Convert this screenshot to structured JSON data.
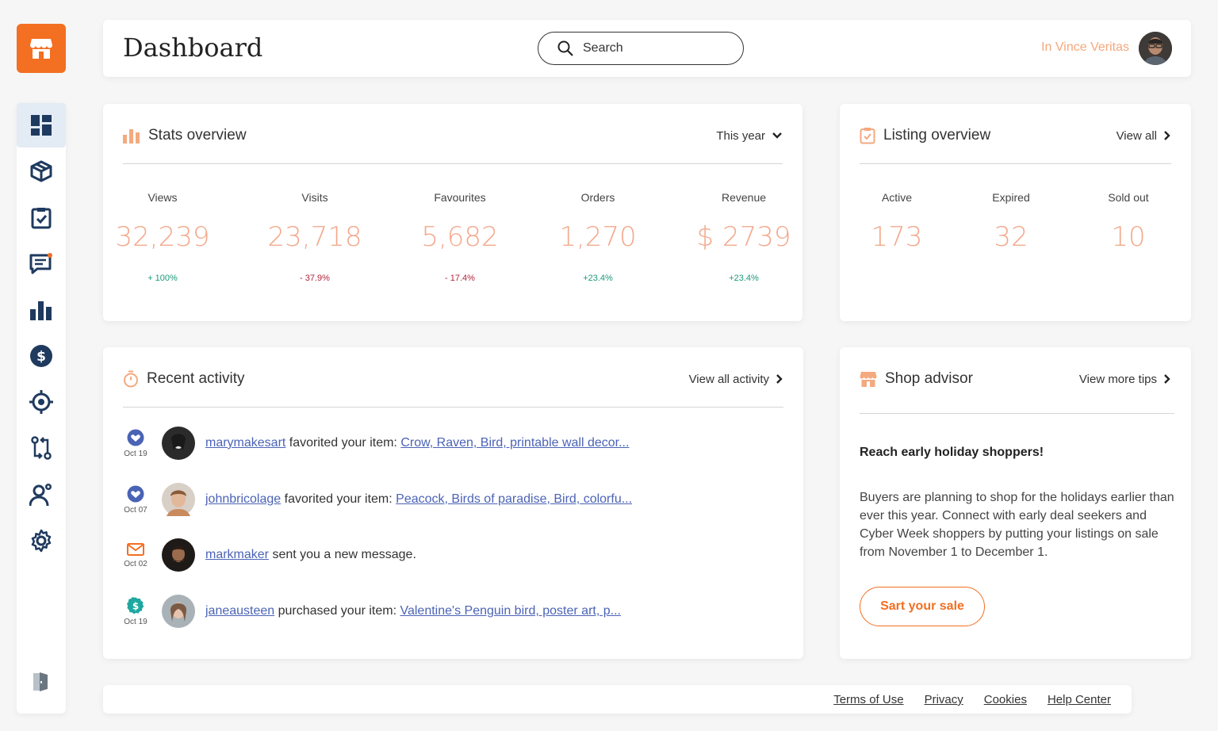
{
  "header": {
    "title": "Dashboard",
    "search_label": "Search",
    "user_name": "In Vince Veritas"
  },
  "sidebar": {
    "items": [
      {
        "icon": "dashboard-icon",
        "active": true
      },
      {
        "icon": "box-icon"
      },
      {
        "icon": "checklist-icon"
      },
      {
        "icon": "messages-icon"
      },
      {
        "icon": "bar-chart-icon"
      },
      {
        "icon": "dollar-icon"
      },
      {
        "icon": "target-icon"
      },
      {
        "icon": "swap-icon"
      },
      {
        "icon": "user-settings-icon"
      },
      {
        "icon": "gear-icon"
      }
    ],
    "bottom_icon": "logout-icon"
  },
  "stats": {
    "title": "Stats overview",
    "period": "This year",
    "items": [
      {
        "label": "Views",
        "value": "32,239",
        "change": "+ 100%",
        "trend": "up"
      },
      {
        "label": "Visits",
        "value": "23,718",
        "change": "- 37.9%",
        "trend": "down"
      },
      {
        "label": "Favourites",
        "value": "5,682",
        "change": "- 17.4%",
        "trend": "down"
      },
      {
        "label": "Orders",
        "value": "1,270",
        "change": "+23.4%",
        "trend": "up"
      },
      {
        "label": "Revenue",
        "value": "$ 2739",
        "change": "+23.4%",
        "trend": "up"
      }
    ]
  },
  "listing": {
    "title": "Listing overview",
    "view_all": "View all",
    "items": [
      {
        "label": "Active",
        "value": "173"
      },
      {
        "label": "Expired",
        "value": "32"
      },
      {
        "label": "Sold out",
        "value": "10"
      }
    ]
  },
  "activity": {
    "title": "Recent activity",
    "view_all": "View all activity",
    "rows": [
      {
        "icon": "heart-icon",
        "date": "Oct 19",
        "user": "marymakesart",
        "action": " favorited your item: ",
        "item": "Crow, Raven, Bird, printable wall decor..."
      },
      {
        "icon": "heart-icon",
        "date": "Oct 07",
        "user": "johnbricolage",
        "action": " favorited your item: ",
        "item": "Peacock, Birds of paradise, Bird, colorfu..."
      },
      {
        "icon": "mail-icon",
        "date": "Oct 02",
        "user": "markmaker",
        "action": " sent you a new message.",
        "item": ""
      },
      {
        "icon": "dollar-icon",
        "date": "Oct 19",
        "user": "janeausteen",
        "action": " purchased your item: ",
        "item": "Valentine's Penguin bird, poster art, p..."
      }
    ]
  },
  "advisor": {
    "title": "Shop advisor",
    "view_more": "View more tips",
    "headline": "Reach early holiday shoppers!",
    "body": "Buyers are planning to shop for the holidays earlier than ever this year. Connect with early deal seekers and Cyber Week shoppers by putting your listings on sale from November 1 to December 1.",
    "button": "Sart your sale"
  },
  "footer": {
    "links": [
      "Terms of Use",
      "Privacy",
      "Cookies",
      "Help Center"
    ]
  },
  "colors": {
    "accent": "#f36f21",
    "value": "#f3a98d",
    "positive": "#1a9a7a",
    "negative": "#b0273c",
    "link": "#4b63b5",
    "nav_icon": "#1f3a5f"
  }
}
